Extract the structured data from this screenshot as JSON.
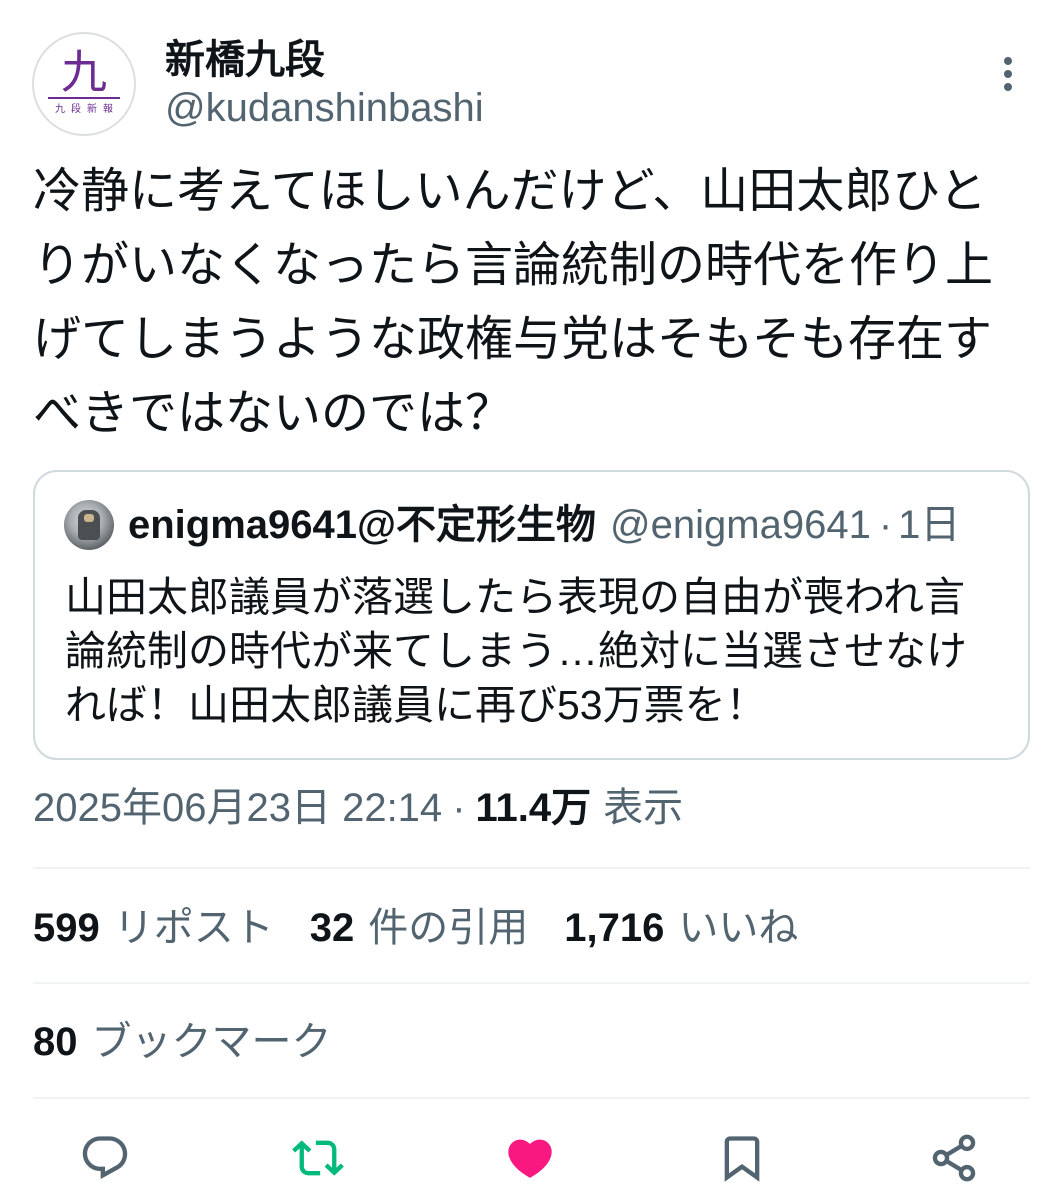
{
  "colors": {
    "text": "#0f1419",
    "secondary": "#536471",
    "border": "#cfd9de",
    "divider": "#eff3f4",
    "repost_active": "#00ba7c",
    "like_active": "#f91880",
    "avatar_accent": "#6d2c91"
  },
  "tweet": {
    "author": {
      "display_name": "新橋九段",
      "handle": "@kudanshinbashi",
      "avatar": {
        "glyph": "九",
        "caption": "九段新報"
      },
      "more_icon": "more-vertical-icon"
    },
    "text": "冷静に考えてほしいんだけど、山田太郎ひとりがいなくなったら言論統制の時代を作り上げてしまうような政権与党はそもそも存在すべきではないのでは？",
    "quote": {
      "author_name": "enigma9641@不定形生物",
      "handle": "@enigma9641",
      "separator": "·",
      "age": "1日",
      "text": "山田太郎議員が落選したら表現の自由が喪われ言論統制の時代が来てしまう…絶対に当選させなければ！山田太郎議員に再び53万票を！"
    },
    "meta": {
      "timestamp": "2025年06月23日 22:14",
      "separator": "·",
      "views_count": "11.4万",
      "views_label": "表示"
    },
    "stats": {
      "reposts": {
        "count": "599",
        "label": "リポスト"
      },
      "quotes": {
        "count": "32",
        "label": "件の引用"
      },
      "likes": {
        "count": "1,716",
        "label": "いいね"
      },
      "bookmarks": {
        "count": "80",
        "label": "ブックマーク"
      }
    },
    "actions": [
      {
        "icon": "reply-icon",
        "active": false
      },
      {
        "icon": "repost-icon",
        "active": true
      },
      {
        "icon": "like-icon",
        "active": true
      },
      {
        "icon": "bookmark-icon",
        "active": false
      },
      {
        "icon": "share-icon",
        "active": false
      }
    ]
  }
}
